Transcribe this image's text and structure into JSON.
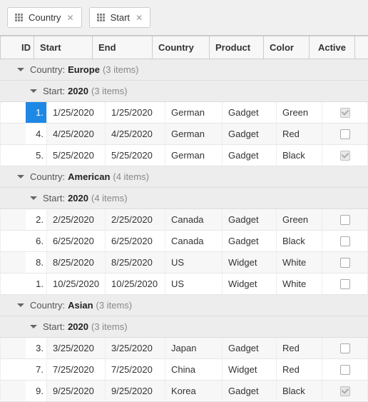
{
  "group_panel": [
    {
      "label": "Country"
    },
    {
      "label": "Start"
    }
  ],
  "columns": {
    "id": "ID",
    "start": "Start",
    "end": "End",
    "country": "Country",
    "product": "Product",
    "color": "Color",
    "active": "Active"
  },
  "groups": {
    "country_label": "Country:",
    "start_label": "Start:",
    "items_suffix": "items"
  },
  "data": [
    {
      "country": "Europe",
      "count": 3,
      "subgroups": [
        {
          "year": "2020",
          "count": 3,
          "rows": [
            {
              "id": "1.",
              "start": "1/25/2020",
              "end": "1/25/2020",
              "country": "German",
              "product": "Gadget",
              "color": "Green",
              "active": true,
              "active_disabled": true,
              "selected": true
            },
            {
              "id": "4.",
              "start": "4/25/2020",
              "end": "4/25/2020",
              "country": "German",
              "product": "Gadget",
              "color": "Red",
              "active": false,
              "active_disabled": false
            },
            {
              "id": "5.",
              "start": "5/25/2020",
              "end": "5/25/2020",
              "country": "German",
              "product": "Gadget",
              "color": "Black",
              "active": true,
              "active_disabled": true
            }
          ]
        }
      ]
    },
    {
      "country": "American",
      "count": 4,
      "subgroups": [
        {
          "year": "2020",
          "count": 4,
          "rows": [
            {
              "id": "2.",
              "start": "2/25/2020",
              "end": "2/25/2020",
              "country": "Canada",
              "product": "Gadget",
              "color": "Green",
              "active": false
            },
            {
              "id": "6.",
              "start": "6/25/2020",
              "end": "6/25/2020",
              "country": "Canada",
              "product": "Gadget",
              "color": "Black",
              "active": false
            },
            {
              "id": "8.",
              "start": "8/25/2020",
              "end": "8/25/2020",
              "country": "US",
              "product": "Widget",
              "color": "White",
              "active": false
            },
            {
              "id": "1.",
              "start": "10/25/2020",
              "end": "10/25/2020",
              "country": "US",
              "product": "Widget",
              "color": "White",
              "active": false
            }
          ]
        }
      ]
    },
    {
      "country": "Asian",
      "count": 3,
      "subgroups": [
        {
          "year": "2020",
          "count": 3,
          "rows": [
            {
              "id": "3.",
              "start": "3/25/2020",
              "end": "3/25/2020",
              "country": "Japan",
              "product": "Gadget",
              "color": "Red",
              "active": false
            },
            {
              "id": "7.",
              "start": "7/25/2020",
              "end": "7/25/2020",
              "country": "China",
              "product": "Widget",
              "color": "Red",
              "active": false
            },
            {
              "id": "9.",
              "start": "9/25/2020",
              "end": "9/25/2020",
              "country": "Korea",
              "product": "Gadget",
              "color": "Black",
              "active": true,
              "active_disabled": true
            }
          ]
        }
      ]
    }
  ]
}
